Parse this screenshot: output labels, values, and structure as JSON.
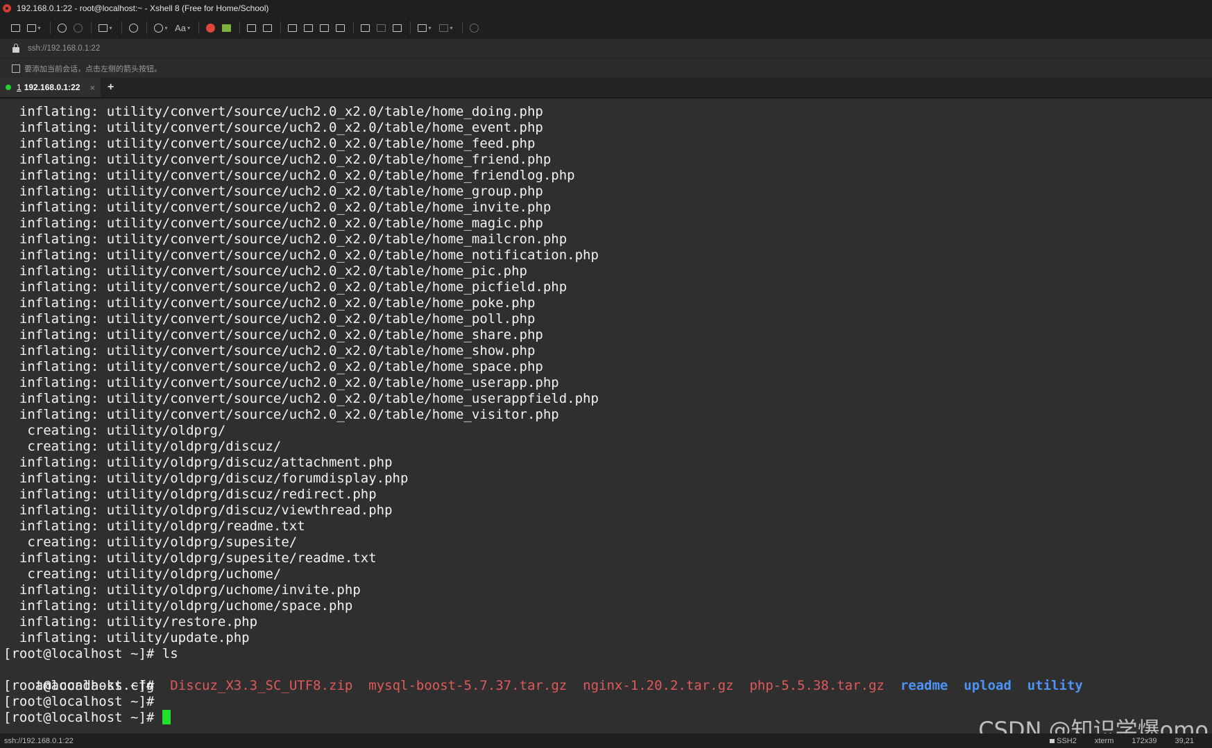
{
  "window": {
    "title": "192.168.0.1:22 - root@localhost:~ - Xshell 8 (Free for Home/School)"
  },
  "toolbar": {
    "icons": [
      "new-session-icon",
      "open-folder-icon",
      "reconnect-icon",
      "disconnect-icon",
      "new-window-icon",
      "search-icon",
      "globe-icon",
      "font-icon",
      "xshell-icon",
      "xftp-icon",
      "fullscreen-icon",
      "lock-icon",
      "compose-icon",
      "highlight-icon",
      "transfer-icon",
      "script-icon",
      "new-tab-icon",
      "tile-icon",
      "cascade-icon",
      "layout-icon",
      "feedback-icon"
    ],
    "font_label": "Aa"
  },
  "address": {
    "value": "ssh://192.168.0.1:22"
  },
  "hint": {
    "text": "要添加当前会话，点击左侧的箭头按钮。"
  },
  "tabs": [
    {
      "number": "1",
      "label": "192.168.0.1:22",
      "close": "×"
    }
  ],
  "new_tab_label": "+",
  "terminal": {
    "lines": [
      "  inflating: utility/convert/source/uch2.0_x2.0/table/home_doing.php",
      "  inflating: utility/convert/source/uch2.0_x2.0/table/home_event.php",
      "  inflating: utility/convert/source/uch2.0_x2.0/table/home_feed.php",
      "  inflating: utility/convert/source/uch2.0_x2.0/table/home_friend.php",
      "  inflating: utility/convert/source/uch2.0_x2.0/table/home_friendlog.php",
      "  inflating: utility/convert/source/uch2.0_x2.0/table/home_group.php",
      "  inflating: utility/convert/source/uch2.0_x2.0/table/home_invite.php",
      "  inflating: utility/convert/source/uch2.0_x2.0/table/home_magic.php",
      "  inflating: utility/convert/source/uch2.0_x2.0/table/home_mailcron.php",
      "  inflating: utility/convert/source/uch2.0_x2.0/table/home_notification.php",
      "  inflating: utility/convert/source/uch2.0_x2.0/table/home_pic.php",
      "  inflating: utility/convert/source/uch2.0_x2.0/table/home_picfield.php",
      "  inflating: utility/convert/source/uch2.0_x2.0/table/home_poke.php",
      "  inflating: utility/convert/source/uch2.0_x2.0/table/home_poll.php",
      "  inflating: utility/convert/source/uch2.0_x2.0/table/home_share.php",
      "  inflating: utility/convert/source/uch2.0_x2.0/table/home_show.php",
      "  inflating: utility/convert/source/uch2.0_x2.0/table/home_space.php",
      "  inflating: utility/convert/source/uch2.0_x2.0/table/home_userapp.php",
      "  inflating: utility/convert/source/uch2.0_x2.0/table/home_userappfield.php",
      "  inflating: utility/convert/source/uch2.0_x2.0/table/home_visitor.php",
      "   creating: utility/oldprg/",
      "   creating: utility/oldprg/discuz/",
      "  inflating: utility/oldprg/discuz/attachment.php",
      "  inflating: utility/oldprg/discuz/forumdisplay.php",
      "  inflating: utility/oldprg/discuz/redirect.php",
      "  inflating: utility/oldprg/discuz/viewthread.php",
      "  inflating: utility/oldprg/readme.txt",
      "   creating: utility/oldprg/supesite/",
      "  inflating: utility/oldprg/supesite/readme.txt",
      "   creating: utility/oldprg/uchome/",
      "  inflating: utility/oldprg/uchome/invite.php",
      "  inflating: utility/oldprg/uchome/space.php",
      "  inflating: utility/restore.php",
      "  inflating: utility/update.php",
      "[root@localhost ~]# ls"
    ],
    "ls_output": [
      {
        "name": "anaconda-ks.cfg",
        "kind": "plain"
      },
      {
        "name": "Discuz_X3.3_SC_UTF8.zip",
        "kind": "archive"
      },
      {
        "name": "mysql-boost-5.7.37.tar.gz",
        "kind": "archive"
      },
      {
        "name": "nginx-1.20.2.tar.gz",
        "kind": "archive"
      },
      {
        "name": "php-5.5.38.tar.gz",
        "kind": "archive"
      },
      {
        "name": "readme",
        "kind": "dir"
      },
      {
        "name": "upload",
        "kind": "dir"
      },
      {
        "name": "utility",
        "kind": "dir"
      }
    ],
    "prompts": [
      "[root@localhost ~]#",
      "[root@localhost ~]#",
      "[root@localhost ~]# "
    ],
    "colors": {
      "archive": "#e05a5a",
      "dir": "#4d93f5",
      "cursor": "#1fe02c",
      "background": "#2f2f2f"
    }
  },
  "watermark": "CSDN @知识学爆omo",
  "status": {
    "address": "ssh://192.168.0.1:22",
    "protocol": "SSH2",
    "terminal": "xterm",
    "size": "172x39",
    "position": "39,21"
  }
}
